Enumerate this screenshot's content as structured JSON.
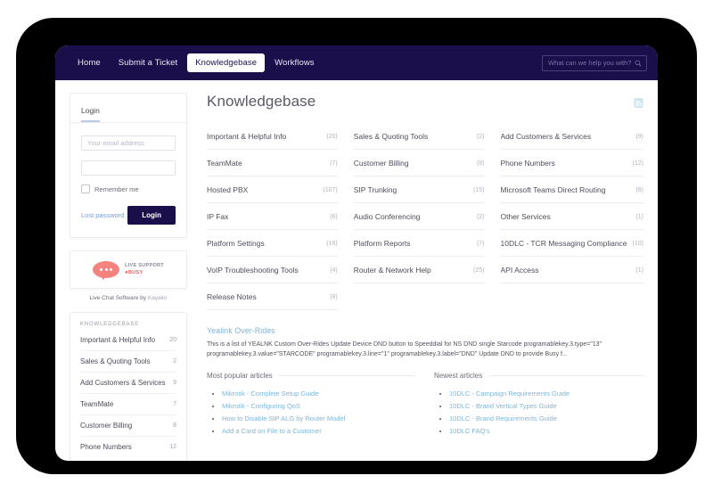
{
  "navbar": {
    "links": [
      {
        "label": "Home",
        "active": false
      },
      {
        "label": "Submit a Ticket",
        "active": false
      },
      {
        "label": "Knowledgebase",
        "active": true
      },
      {
        "label": "Workflows",
        "active": false
      }
    ],
    "search": {
      "value": "",
      "placeholder": "What can we help you with?",
      "icon": "search-icon"
    },
    "background": "#1b0f4b"
  },
  "sidebar": {
    "login": {
      "tab_label": "Login",
      "email": {
        "value": "",
        "placeholder": "Your email address"
      },
      "password": {
        "value": "",
        "placeholder": ""
      },
      "remember_label": "Remember me",
      "remember_checked": false,
      "lost_password_label": "Lost password",
      "login_button_label": "Login"
    },
    "chat": {
      "title": "LIVE SUPPORT",
      "status": "BUSY",
      "status_bullet": "●",
      "caption_prefix": "Live Chat Software by ",
      "caption_brand": "Kayako",
      "accent": "#f4827f",
      "status_color": "#ef5b59"
    },
    "kb": {
      "heading": "KNOWLEDGEBASE",
      "items": [
        {
          "label": "Important & Helpful Info",
          "count": "20"
        },
        {
          "label": "Sales & Quoting Tools",
          "count": "2"
        },
        {
          "label": "Add Customers & Services",
          "count": "9"
        },
        {
          "label": "TeamMate",
          "count": "7"
        },
        {
          "label": "Customer Billing",
          "count": "8"
        },
        {
          "label": "Phone Numbers",
          "count": "12"
        }
      ]
    }
  },
  "main": {
    "title": "Knowledgebase",
    "rss_icon": "rss-feed-icon",
    "categories": [
      {
        "label": "Important & Helpful Info",
        "count": "(20)"
      },
      {
        "label": "Sales & Quoting Tools",
        "count": "(2)"
      },
      {
        "label": "Add Customers & Services",
        "count": "(9)"
      },
      {
        "label": "TeamMate",
        "count": "(7)"
      },
      {
        "label": "Customer Billing",
        "count": "(8)"
      },
      {
        "label": "Phone Numbers",
        "count": "(12)"
      },
      {
        "label": "Hosted PBX",
        "count": "(107)"
      },
      {
        "label": "SIP Trunking",
        "count": "(15)"
      },
      {
        "label": "Microsoft Teams Direct Routing",
        "count": "(8)"
      },
      {
        "label": "IP Fax",
        "count": "(6)"
      },
      {
        "label": "Audio Conferencing",
        "count": "(2)"
      },
      {
        "label": "Other Services",
        "count": "(1)"
      },
      {
        "label": "Platform Settings",
        "count": "(16)"
      },
      {
        "label": "Platform Reports",
        "count": "(7)"
      },
      {
        "label": "10DLC - TCR Messaging Compliance",
        "count": "(10)"
      },
      {
        "label": "VoIP Troubleshooting Tools",
        "count": "(4)"
      },
      {
        "label": "Router & Network Help",
        "count": "(25)"
      },
      {
        "label": "API Access",
        "count": "(1)"
      },
      {
        "label": "Release Notes",
        "count": "(8)"
      }
    ],
    "feature": {
      "title": "Yealink Over-Rides",
      "excerpt": "This is a list of YEALNK Custom Over-Rides Update Device DND button to Speeddial for NS DND single Starcode programablekey.3.type=\"13\" programablekey.3.value=\"STARCODE\" programablekey.3.line=\"1\" programablekey.3.label=\"DND\" Update DND to provide Busy f..."
    },
    "popular": {
      "heading": "Most popular articles",
      "items": [
        "Mikrotik - Complete Setup Guide",
        "Mikrotik - Configuring QoS",
        "How to Disable SIP ALG by Router Model",
        "Add a Card on File to a Customer"
      ]
    },
    "newest": {
      "heading": "Newest articles",
      "items": [
        "10DLC - Campaign Requirements Guide",
        "10DLC - Brand Vertical Types Guide",
        "10DLC - Brand Requirements Guide",
        "10DLC FAQ's"
      ]
    }
  }
}
